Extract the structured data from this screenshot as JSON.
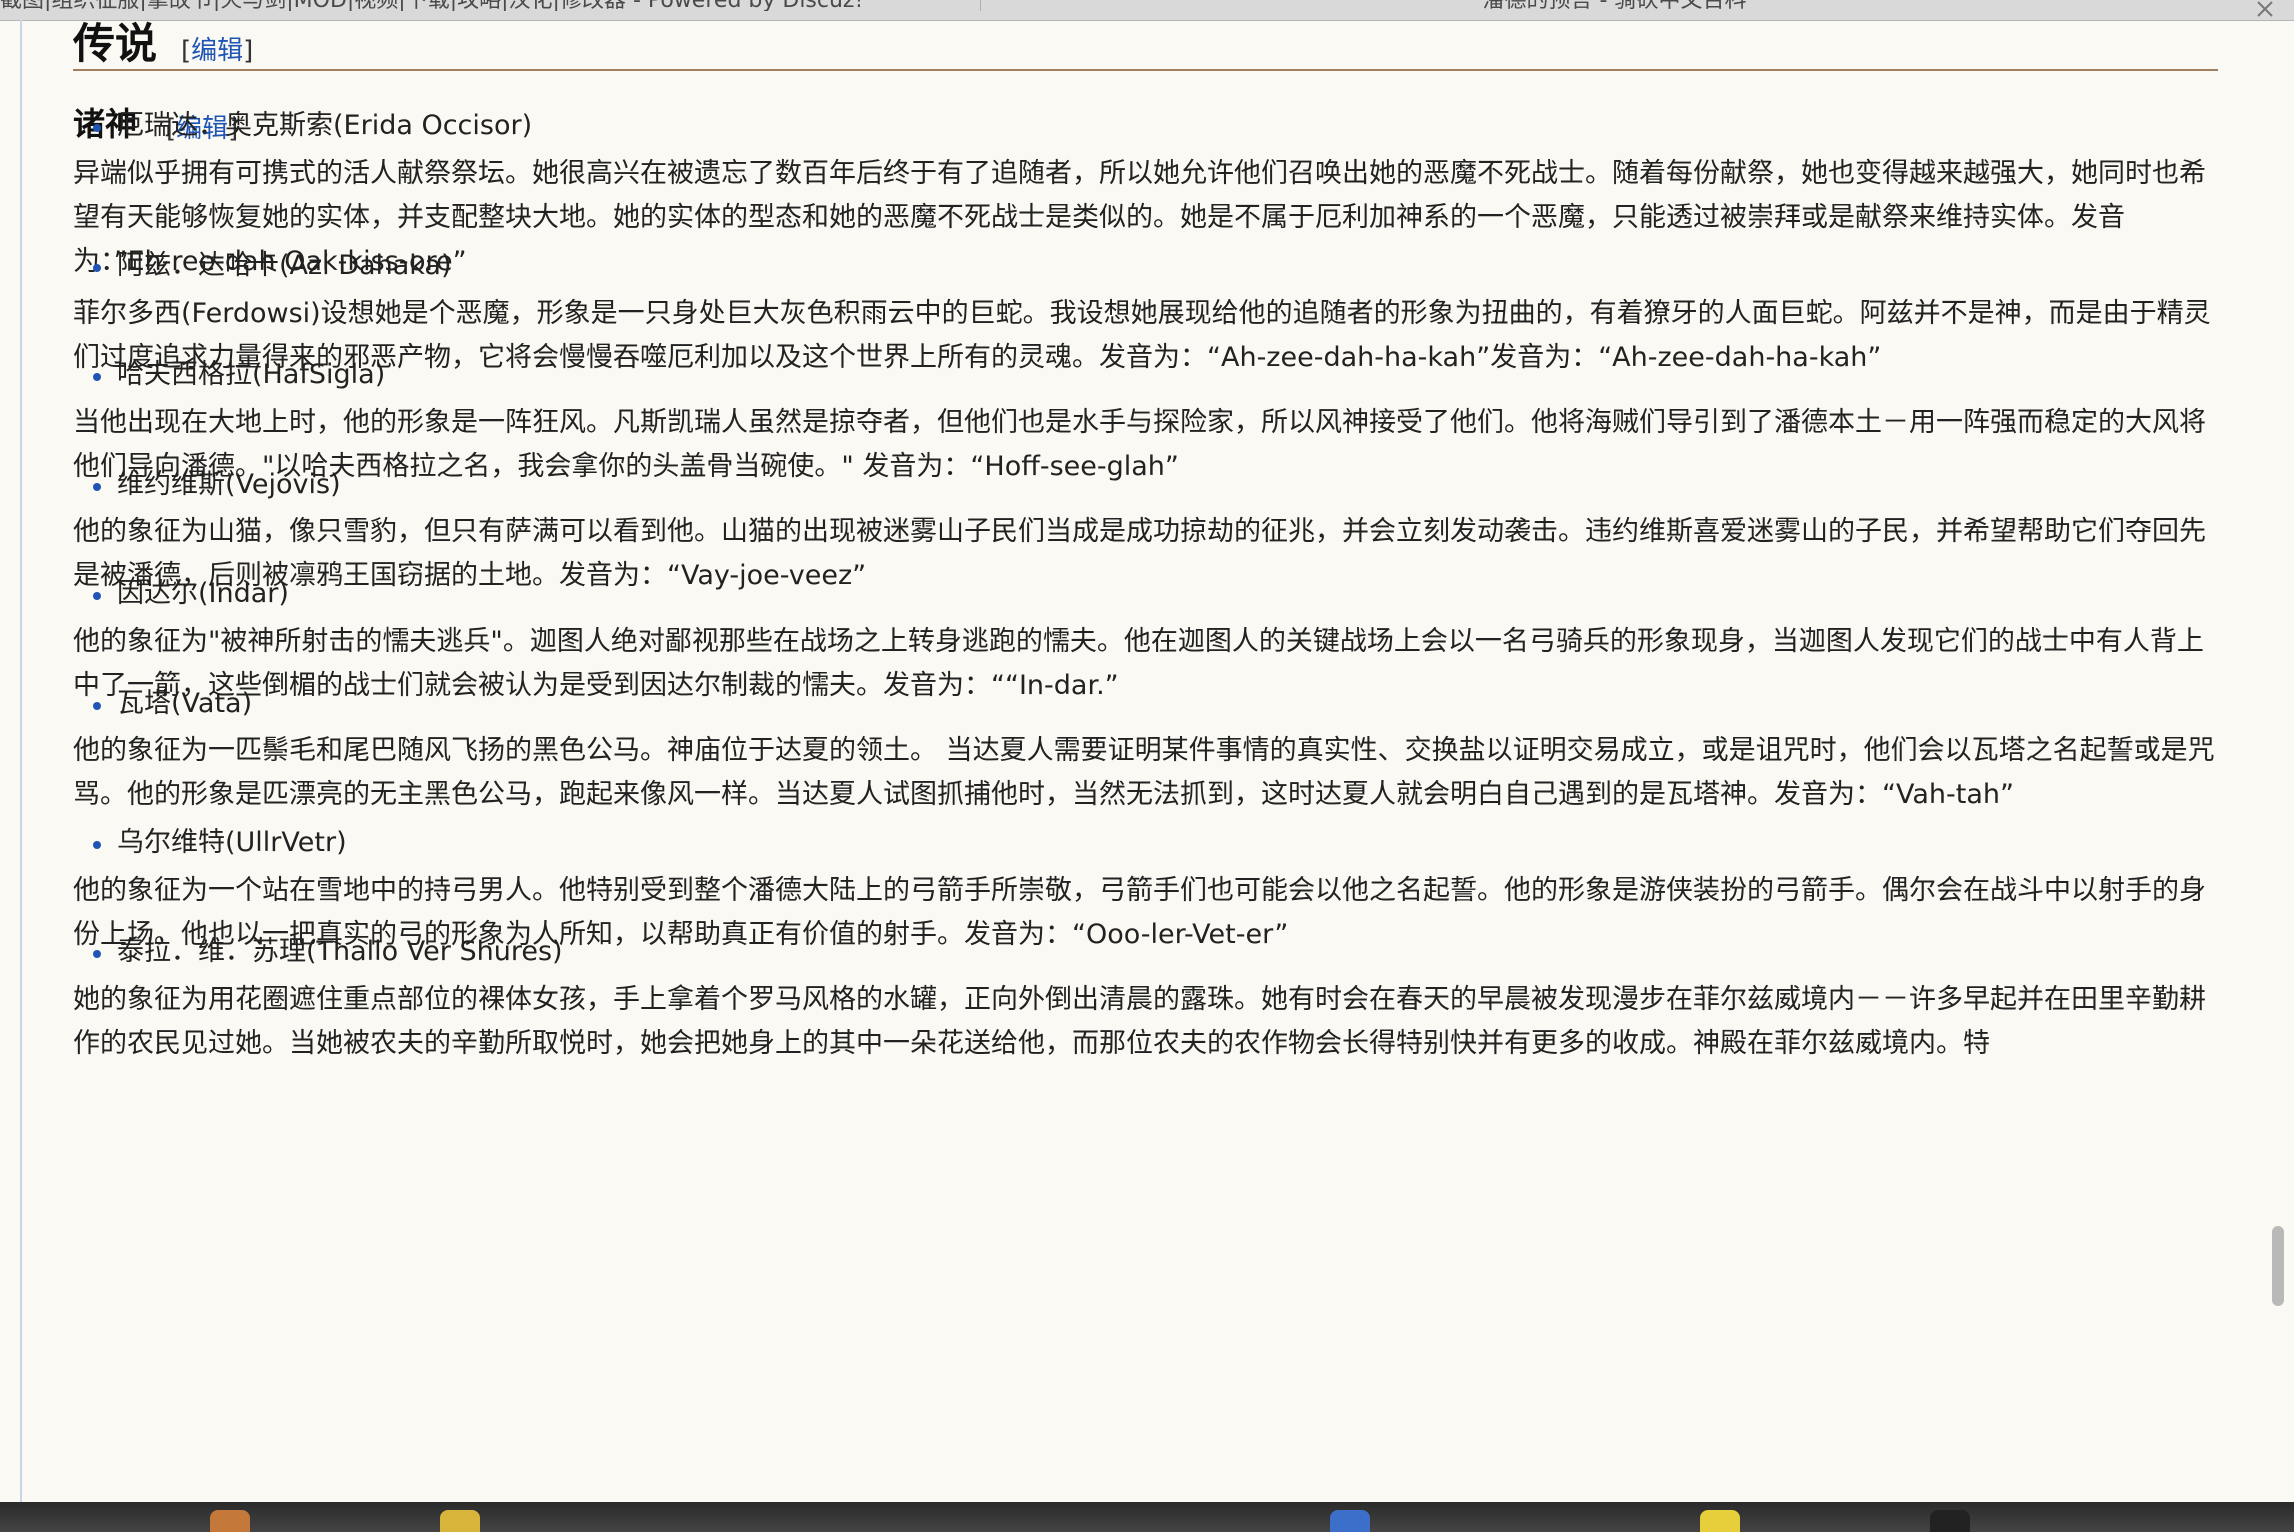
{
  "tabs": [
    {
      "label": "截图|组织征服|掌故节|火与剑|MOD|视频|下载|攻略|汉化|修改器 - Powered by Discuz!"
    },
    {
      "label": "潘德的预言 - 骑砍中文百科"
    }
  ],
  "section": {
    "title": "传说",
    "edit_label": "编辑"
  },
  "subsection": {
    "title": "诸神",
    "edit_label": "编辑"
  },
  "entries": [
    {
      "name": "厄瑞达．奥克斯索(Erida Occisor)",
      "text": "异端似乎拥有可携式的活人献祭祭坛。她很高兴在被遗忘了数百年后终于有了追随者，所以她允许他们召唤出她的恶魔不死战士。随着每份献祭，她也变得越来越强大，她同时也希望有天能够恢复她的实体，并支配整块大地。她的实体的型态和她的恶魔不死战士是类似的。她是不属于厄利加神系的一个恶魔，只能透过被崇拜或是献祭来维持实体。发音为：”Eh-ree-dah Oak-kiss-ore”"
    },
    {
      "name": "阿兹．达哈卡(Azi Dahaka)",
      "text": "菲尔多西(Ferdowsi)设想她是个恶魔，形象是一只身处巨大灰色积雨云中的巨蛇。我设想她展现给他的追随者的形象为扭曲的，有着獠牙的人面巨蛇。阿兹并不是神，而是由于精灵们过度追求力量得来的邪恶产物，它将会慢慢吞噬厄利加以及这个世界上所有的灵魂。发音为：“Ah-zee-dah-ha-kah”发音为：“Ah-zee-dah-ha-kah”"
    },
    {
      "name": "哈夫西格拉(HafSigla)",
      "text": "当他出现在大地上时，他的形象是一阵狂风。凡斯凯瑞人虽然是掠夺者，但他们也是水手与探险家，所以风神接受了他们。他将海贼们导引到了潘德本土－用一阵强而稳定的大风将他们导向潘德。\"以哈夫西格拉之名，我会拿你的头盖骨当碗使。\" 发音为：“Hoff-see-glah”"
    },
    {
      "name": "维约维斯(Vejovis)",
      "text": "他的象征为山猫，像只雪豹，但只有萨满可以看到他。山猫的出现被迷雾山子民们当成是成功掠劫的征兆，并会立刻发动袭击。违约维斯喜爱迷雾山的子民，并希望帮助它们夺回先是被潘德，后则被凛鸦王国窃据的土地。发音为：“Vay-joe-veez”"
    },
    {
      "name": "因达尔(Indar)",
      "text": "他的象征为\"被神所射击的懦夫逃兵\"。迦图人绝对鄙视那些在战场之上转身逃跑的懦夫。他在迦图人的关键战场上会以一名弓骑兵的形象现身，当迦图人发现它们的战士中有人背上中了一箭，这些倒楣的战士们就会被认为是受到因达尔制裁的懦夫。发音为：““In-dar.”"
    },
    {
      "name": "瓦塔(Vata)",
      "text": "他的象征为一匹鬃毛和尾巴随风飞扬的黑色公马。神庙位于达夏的领土。 当达夏人需要证明某件事情的真实性、交换盐以证明交易成立，或是诅咒时，他们会以瓦塔之名起誓或是咒骂。他的形象是匹漂亮的无主黑色公马，跑起来像风一样。当达夏人试图抓捕他时，当然无法抓到，这时达夏人就会明白自己遇到的是瓦塔神。发音为：“Vah-tah”"
    },
    {
      "name": "乌尔维特(UllrVetr)",
      "text": "他的象征为一个站在雪地中的持弓男人。他特别受到整个潘德大陆上的弓箭手所崇敬，弓箭手们也可能会以他之名起誓。他的形象是游侠装扮的弓箭手。偶尔会在战斗中以射手的身份上场。他也以一把真实的弓的形象为人所知，以帮助真正有价值的射手。发音为：“Ooo-ler-Vet-er”"
    },
    {
      "name": "泰拉．维．苏理(Thallo Ver Shures)",
      "text": "她的象征为用花圈遮住重点部位的裸体女孩，手上拿着个罗马风格的水罐，正向外倒出清晨的露珠。她有时会在春天的早晨被发现漫步在菲尔兹威境内－－许多早起并在田里辛勤耕作的农民见过她。当她被农夫的辛勤所取悦时，她会把她身上的其中一朵花送给他，而那位农夫的农作物会长得特别快并有更多的收成。神殿在菲尔兹威境内。特"
    }
  ]
}
